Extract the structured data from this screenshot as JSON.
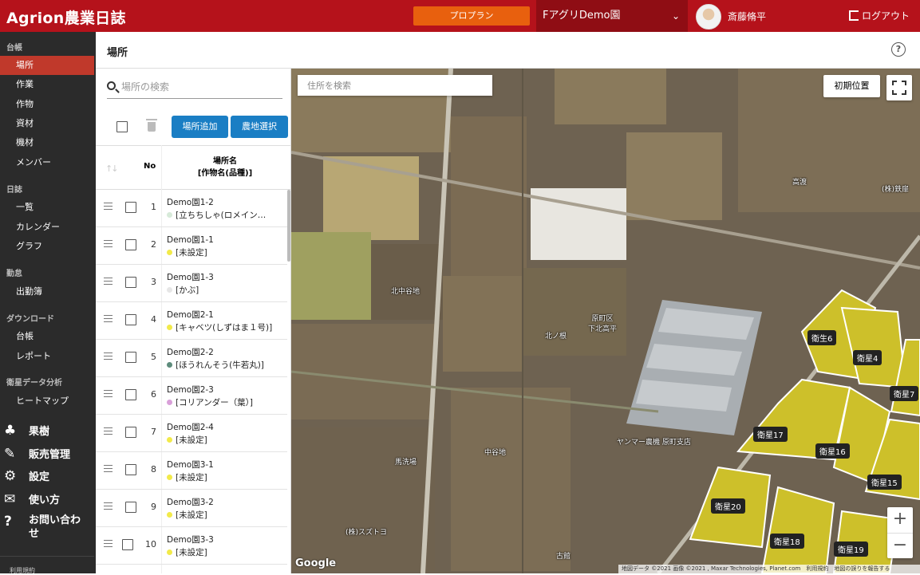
{
  "header": {
    "logo": "Agrion農業日誌",
    "pro_plan": "プロプラン",
    "farm_name": "FアグリDemo園",
    "user_name": "斎藤脩平",
    "logout": "ログアウト"
  },
  "sidebar": {
    "sections": [
      {
        "label": "台帳",
        "items": [
          "場所",
          "作業",
          "作物",
          "資材",
          "機材",
          "メンバー"
        ]
      },
      {
        "label": "日誌",
        "items": [
          "一覧",
          "カレンダー",
          "グラフ"
        ]
      },
      {
        "label": "勤怠",
        "items": [
          "出勤簿"
        ]
      },
      {
        "label": "ダウンロード",
        "items": [
          "台帳",
          "レポート"
        ]
      },
      {
        "label": "衛星データ分析",
        "items": [
          "ヒートマップ"
        ]
      }
    ],
    "active": "場所",
    "big": [
      "果樹",
      "販売管理",
      "設定",
      "使い方",
      "お問い合わせ"
    ],
    "footer": "利用規約"
  },
  "page": {
    "title": "場所",
    "help": "?"
  },
  "list": {
    "search_placeholder": "場所の検索",
    "add_button": "場所追加",
    "select_button": "農地選択",
    "col_no": "No",
    "col_name_1": "場所名",
    "col_name_2": "[作物名(品種)]",
    "rows": [
      {
        "no": "1",
        "name": "Demo園1-2",
        "crop": "[立ちちしゃ(ロメイン…",
        "dot": "#d7ead9"
      },
      {
        "no": "2",
        "name": "Demo園1-1",
        "crop": "[未設定]",
        "dot": "#f2ea4a"
      },
      {
        "no": "3",
        "name": "Demo園1-3",
        "crop": "[かぶ]",
        "dot": "#e6e6e6"
      },
      {
        "no": "4",
        "name": "Demo園2-1",
        "crop": "[キャベツ(しずはま１号)]",
        "dot": "#f2ea4a"
      },
      {
        "no": "5",
        "name": "Demo園2-2",
        "crop": "[ほうれんそう(牛若丸)]",
        "dot": "#5e8c7c"
      },
      {
        "no": "6",
        "name": "Demo園2-3",
        "crop": "[コリアンダー（葉）]",
        "dot": "#d9a0d9"
      },
      {
        "no": "7",
        "name": "Demo園2-4",
        "crop": "[未設定]",
        "dot": "#f2ea4a"
      },
      {
        "no": "8",
        "name": "Demo園3-1",
        "crop": "[未設定]",
        "dot": "#f2ea4a"
      },
      {
        "no": "9",
        "name": "Demo園3-2",
        "crop": "[未設定]",
        "dot": "#f2ea4a"
      },
      {
        "no": "10",
        "name": "Demo園3-3",
        "crop": "[未設定]",
        "dot": "#f2ea4a"
      }
    ]
  },
  "map": {
    "address_placeholder": "住所を検索",
    "initial_position": "初期位置",
    "zoom_in": "+",
    "zoom_out": "−",
    "google": "Google",
    "attribution": "地図データ ©2021 画像 ©2021 , Maxar Technologies, Planet.com　利用規約　地図の誤りを報告する",
    "place_labels": [
      "北中谷地",
      "北ノ根",
      "原町区\n下北高平",
      "中谷地",
      "馬洗場",
      "ヤンマー農機 原町支店",
      "(株)スズトヨ",
      "(株)鉄扉",
      "古館",
      "高渡"
    ],
    "satellites": [
      "衛生6",
      "衛星4",
      "衛星7",
      "衛星17",
      "衛星16",
      "衛星15",
      "衛星20",
      "衛星18",
      "衛星19"
    ]
  },
  "colors": {
    "header": "#b5121b",
    "accent_button": "#e8600e",
    "primary": "#1a7ec4",
    "field_highlight": "#cdc02a"
  }
}
